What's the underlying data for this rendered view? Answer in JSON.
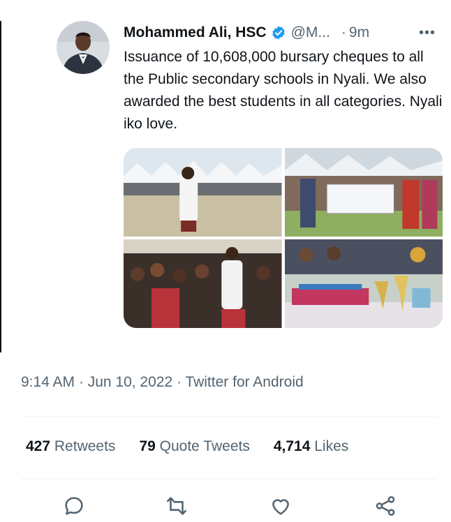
{
  "tweet": {
    "author_name": "Mohammed Ali, HSC",
    "handle": "@M...",
    "separator": "·",
    "relative_time": "9m",
    "more": "•••",
    "text": "Issuance of 10,608,000 bursary cheques to all the Public secondary schools in Nyali. We also awarded the best students in all categories. Nyali iko love.",
    "media_icons": [
      "ceremony-field-photo",
      "cheque-presentation-photo",
      "crowd-award-photo",
      "trophies-table-photo"
    ]
  },
  "meta": {
    "timestamp": "9:14 AM · Jun 10, 2022 · Twitter for Android"
  },
  "stats": {
    "retweets_count": "427",
    "retweets_label": "Retweets",
    "quotes_count": "79",
    "quotes_label": "Quote Tweets",
    "likes_count": "4,714",
    "likes_label": "Likes"
  },
  "actions": [
    "reply-icon",
    "retweet-icon",
    "like-icon",
    "share-icon"
  ],
  "colors": {
    "verified": "#1d9bf0",
    "secondary_text": "#536471",
    "text": "#0f1419"
  }
}
